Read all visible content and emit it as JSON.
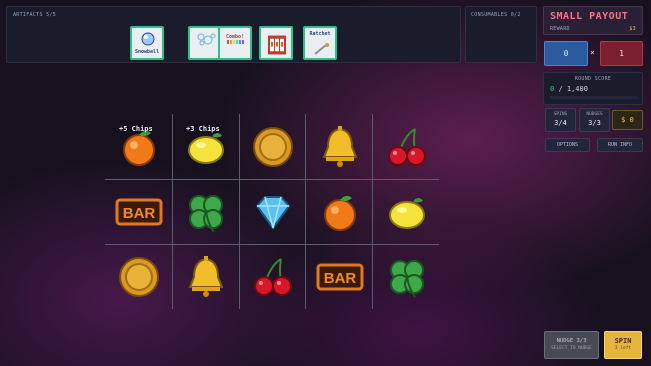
{
  "artifacts": {
    "header": "ARTIFACTS 5/5",
    "items": [
      {
        "label": "Snowball",
        "icon": "snowball-icon"
      },
      {
        "label": "",
        "icon": "bubbles-icon"
      },
      {
        "label": "Combo!",
        "icon": "combo-icon"
      },
      {
        "label": "",
        "icon": "slot-machine-icon"
      },
      {
        "label": "Ratchet",
        "icon": "ratchet-icon"
      }
    ]
  },
  "consumables": {
    "header": "CONSUMABLES 0/2"
  },
  "blind": {
    "title": "SMALL PAYOUT",
    "reward_label": "REWARD",
    "reward_value": "$3"
  },
  "score": {
    "chips": "0",
    "times": "×",
    "mult": "1"
  },
  "round_score": {
    "header": "ROUND SCORE",
    "current": "0",
    "target": "/ 1,400",
    "progress": 0
  },
  "stats": {
    "spins": {
      "label": "SPINS",
      "value": "3/4"
    },
    "nudges": {
      "label": "NUDGES",
      "value": "3/3"
    },
    "gold": "$ 0"
  },
  "buttons": {
    "options": "OPTIONS",
    "run_info": "RUN INFO"
  },
  "reels": {
    "rows": [
      [
        "orange",
        "lemon",
        "coin",
        "bell",
        "cherry"
      ],
      [
        "bar",
        "clover",
        "diamond",
        "orange",
        "lemon"
      ],
      [
        "coin",
        "bell",
        "cherry",
        "bar",
        "clover"
      ]
    ],
    "bonuses": [
      "+5 Chips",
      "+3 Chips"
    ],
    "bar_text": "BAR"
  },
  "nudge_button": {
    "label": "NUDGE 3/3",
    "hint": "SELECT TO NUDGE"
  },
  "spin_button": {
    "label": "SPIN",
    "hint": "3 left"
  },
  "colors": {
    "chips": "#2c5a9e",
    "mult": "#7a1f2e",
    "spin": "#e6b63c",
    "accent": "#ff6e8a"
  }
}
